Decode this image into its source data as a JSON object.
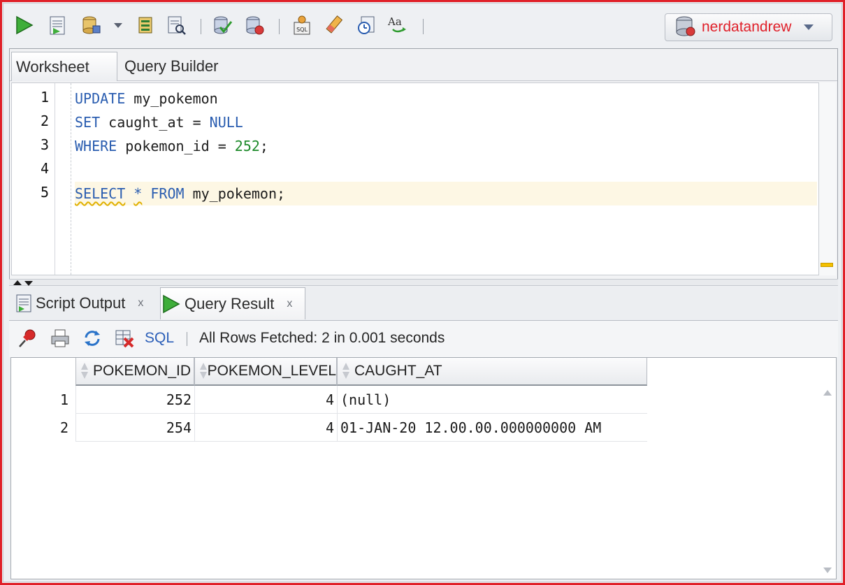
{
  "colors": {
    "accent_red": "#e02028",
    "keyword_blue": "#2a5db0",
    "number_green": "#1d8a2a",
    "current_line": "#fdf7e4"
  },
  "toolbar": {
    "icons": [
      "run-statement-icon",
      "run-script-icon",
      "commit-icon",
      "dropdown-caret-icon",
      "rollback-icon",
      "explain-plan-icon",
      "autotrace-icon",
      "sql-history-icon",
      "sql-tuning-icon",
      "clear-icon",
      "clock-icon",
      "format-text-icon"
    ],
    "connection": {
      "label": "nerdatandrew",
      "icon": "database-icon"
    }
  },
  "editor": {
    "tabs": [
      {
        "label": "Worksheet"
      },
      {
        "label": "Query Builder"
      }
    ],
    "line_numbers": [
      "1",
      "2",
      "3",
      "4",
      "5"
    ],
    "lines": [
      {
        "parts": [
          {
            "t": "UPDATE",
            "k": "kw"
          },
          {
            "t": " my_pokemon",
            "k": ""
          }
        ]
      },
      {
        "parts": [
          {
            "t": "SET",
            "k": "kw"
          },
          {
            "t": " caught_at = ",
            "k": ""
          },
          {
            "t": "NULL",
            "k": "kw"
          }
        ]
      },
      {
        "parts": [
          {
            "t": "WHERE",
            "k": "kw"
          },
          {
            "t": " pokemon_id = ",
            "k": ""
          },
          {
            "t": "252",
            "k": "num"
          },
          {
            "t": ";",
            "k": ""
          }
        ]
      },
      {
        "parts": []
      },
      {
        "parts": [
          {
            "t": "SELECT",
            "k": "kw sq"
          },
          {
            "t": " ",
            "k": ""
          },
          {
            "t": "*",
            "k": "kw sq"
          },
          {
            "t": " ",
            "k": ""
          },
          {
            "t": "FROM",
            "k": "kw"
          },
          {
            "t": " my_pokemon;",
            "k": ""
          }
        ]
      }
    ]
  },
  "output": {
    "tabs": [
      {
        "label": "Script Output",
        "close": "x"
      },
      {
        "label": "Query Result",
        "close": "x"
      }
    ],
    "toolbar": {
      "sql_label": "SQL",
      "status": "All Rows Fetched: 2 in 0.001 seconds"
    },
    "grid": {
      "columns": [
        "POKEMON_ID",
        "POKEMON_LEVEL",
        "CAUGHT_AT"
      ],
      "rows": [
        {
          "num": "1",
          "cells": [
            "252",
            "4",
            "(null)"
          ]
        },
        {
          "num": "2",
          "cells": [
            "254",
            "4",
            "01-JAN-20 12.00.00.000000000 AM"
          ]
        }
      ]
    }
  }
}
